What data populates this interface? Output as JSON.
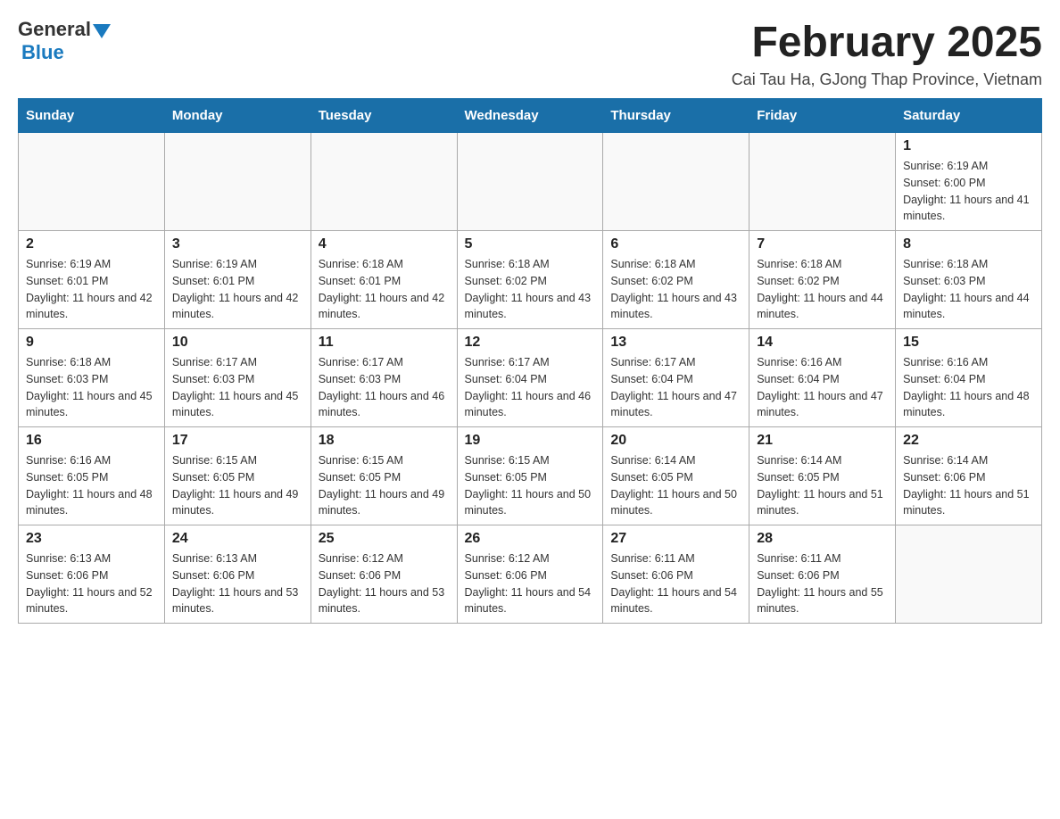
{
  "header": {
    "logo_general": "General",
    "logo_blue": "Blue",
    "month_title": "February 2025",
    "location": "Cai Tau Ha, GJong Thap Province, Vietnam"
  },
  "days_of_week": [
    "Sunday",
    "Monday",
    "Tuesday",
    "Wednesday",
    "Thursday",
    "Friday",
    "Saturday"
  ],
  "weeks": [
    [
      {
        "day": "",
        "info": ""
      },
      {
        "day": "",
        "info": ""
      },
      {
        "day": "",
        "info": ""
      },
      {
        "day": "",
        "info": ""
      },
      {
        "day": "",
        "info": ""
      },
      {
        "day": "",
        "info": ""
      },
      {
        "day": "1",
        "info": "Sunrise: 6:19 AM\nSunset: 6:00 PM\nDaylight: 11 hours and 41 minutes."
      }
    ],
    [
      {
        "day": "2",
        "info": "Sunrise: 6:19 AM\nSunset: 6:01 PM\nDaylight: 11 hours and 42 minutes."
      },
      {
        "day": "3",
        "info": "Sunrise: 6:19 AM\nSunset: 6:01 PM\nDaylight: 11 hours and 42 minutes."
      },
      {
        "day": "4",
        "info": "Sunrise: 6:18 AM\nSunset: 6:01 PM\nDaylight: 11 hours and 42 minutes."
      },
      {
        "day": "5",
        "info": "Sunrise: 6:18 AM\nSunset: 6:02 PM\nDaylight: 11 hours and 43 minutes."
      },
      {
        "day": "6",
        "info": "Sunrise: 6:18 AM\nSunset: 6:02 PM\nDaylight: 11 hours and 43 minutes."
      },
      {
        "day": "7",
        "info": "Sunrise: 6:18 AM\nSunset: 6:02 PM\nDaylight: 11 hours and 44 minutes."
      },
      {
        "day": "8",
        "info": "Sunrise: 6:18 AM\nSunset: 6:03 PM\nDaylight: 11 hours and 44 minutes."
      }
    ],
    [
      {
        "day": "9",
        "info": "Sunrise: 6:18 AM\nSunset: 6:03 PM\nDaylight: 11 hours and 45 minutes."
      },
      {
        "day": "10",
        "info": "Sunrise: 6:17 AM\nSunset: 6:03 PM\nDaylight: 11 hours and 45 minutes."
      },
      {
        "day": "11",
        "info": "Sunrise: 6:17 AM\nSunset: 6:03 PM\nDaylight: 11 hours and 46 minutes."
      },
      {
        "day": "12",
        "info": "Sunrise: 6:17 AM\nSunset: 6:04 PM\nDaylight: 11 hours and 46 minutes."
      },
      {
        "day": "13",
        "info": "Sunrise: 6:17 AM\nSunset: 6:04 PM\nDaylight: 11 hours and 47 minutes."
      },
      {
        "day": "14",
        "info": "Sunrise: 6:16 AM\nSunset: 6:04 PM\nDaylight: 11 hours and 47 minutes."
      },
      {
        "day": "15",
        "info": "Sunrise: 6:16 AM\nSunset: 6:04 PM\nDaylight: 11 hours and 48 minutes."
      }
    ],
    [
      {
        "day": "16",
        "info": "Sunrise: 6:16 AM\nSunset: 6:05 PM\nDaylight: 11 hours and 48 minutes."
      },
      {
        "day": "17",
        "info": "Sunrise: 6:15 AM\nSunset: 6:05 PM\nDaylight: 11 hours and 49 minutes."
      },
      {
        "day": "18",
        "info": "Sunrise: 6:15 AM\nSunset: 6:05 PM\nDaylight: 11 hours and 49 minutes."
      },
      {
        "day": "19",
        "info": "Sunrise: 6:15 AM\nSunset: 6:05 PM\nDaylight: 11 hours and 50 minutes."
      },
      {
        "day": "20",
        "info": "Sunrise: 6:14 AM\nSunset: 6:05 PM\nDaylight: 11 hours and 50 minutes."
      },
      {
        "day": "21",
        "info": "Sunrise: 6:14 AM\nSunset: 6:05 PM\nDaylight: 11 hours and 51 minutes."
      },
      {
        "day": "22",
        "info": "Sunrise: 6:14 AM\nSunset: 6:06 PM\nDaylight: 11 hours and 51 minutes."
      }
    ],
    [
      {
        "day": "23",
        "info": "Sunrise: 6:13 AM\nSunset: 6:06 PM\nDaylight: 11 hours and 52 minutes."
      },
      {
        "day": "24",
        "info": "Sunrise: 6:13 AM\nSunset: 6:06 PM\nDaylight: 11 hours and 53 minutes."
      },
      {
        "day": "25",
        "info": "Sunrise: 6:12 AM\nSunset: 6:06 PM\nDaylight: 11 hours and 53 minutes."
      },
      {
        "day": "26",
        "info": "Sunrise: 6:12 AM\nSunset: 6:06 PM\nDaylight: 11 hours and 54 minutes."
      },
      {
        "day": "27",
        "info": "Sunrise: 6:11 AM\nSunset: 6:06 PM\nDaylight: 11 hours and 54 minutes."
      },
      {
        "day": "28",
        "info": "Sunrise: 6:11 AM\nSunset: 6:06 PM\nDaylight: 11 hours and 55 minutes."
      },
      {
        "day": "",
        "info": ""
      }
    ]
  ]
}
